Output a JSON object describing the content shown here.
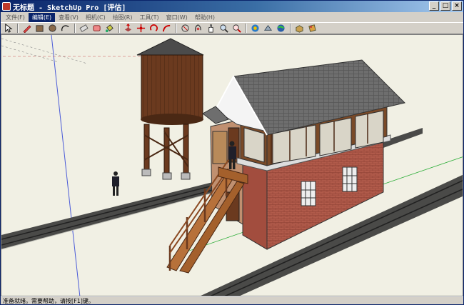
{
  "window": {
    "title": "无标题 - SketchUp Pro [评估]"
  },
  "window_controls": {
    "minimize": "_",
    "maximize": "□",
    "close": "×"
  },
  "menu": [
    {
      "label": "文件(F)"
    },
    {
      "label": "编辑(E)"
    },
    {
      "label": "查看(V)"
    },
    {
      "label": "相机(C)"
    },
    {
      "label": "绘图(R)"
    },
    {
      "label": "工具(T)"
    },
    {
      "label": "窗口(W)"
    },
    {
      "label": "帮助(H)"
    }
  ],
  "active_menu": "编辑(E)",
  "toolbar": {
    "icons": [
      "select-icon",
      "pencil-line-icon",
      "rectangle-icon",
      "circle-icon",
      "arc-icon",
      "eraser-icon",
      "tape-measure-icon",
      "paint-bucket-icon",
      "push-pull-icon",
      "move-icon",
      "rotate-icon",
      "follow-me-icon",
      "offset-icon",
      "orbit-icon",
      "pan-icon",
      "zoom-icon",
      "zoom-extents-icon",
      "get-models-icon",
      "share-model-icon",
      "google-earth-icon",
      "components-icon",
      "materials-icon"
    ]
  },
  "status": {
    "text": "准备就绪。需要帮助，请按[F1]键。"
  },
  "colors": {
    "titlebar": "#0a246a",
    "viewport_bg": "#f1f0e4",
    "roof": "#6e6e6e",
    "brick": "#b05a4a",
    "wood": "#6b3a1f"
  }
}
